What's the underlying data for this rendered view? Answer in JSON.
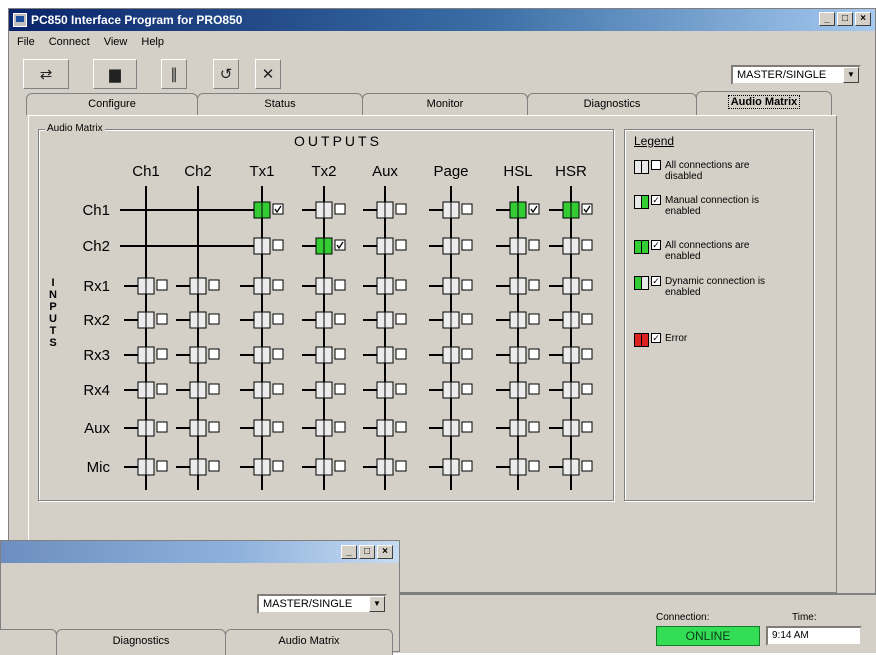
{
  "window": {
    "title": "PC850 Interface Program for PRO850"
  },
  "menu": [
    "File",
    "Connect",
    "View",
    "Help"
  ],
  "mode": {
    "selected": "MASTER/SINGLE"
  },
  "tabs": [
    {
      "label": "Configure",
      "active": false
    },
    {
      "label": "Status",
      "active": false
    },
    {
      "label": "Monitor",
      "active": false
    },
    {
      "label": "Diagnostics",
      "active": false
    },
    {
      "label": "Audio Matrix",
      "active": true
    }
  ],
  "matrix": {
    "group_label": "Audio Matrix",
    "outputs_label": "OUTPUTS",
    "inputs_label": "INPUTS",
    "outputs": [
      "Ch1",
      "Ch2",
      "Tx1",
      "Tx2",
      "Aux",
      "Page",
      "HSL",
      "HSR"
    ],
    "inputs": [
      "Ch1",
      "Ch2",
      "Rx1",
      "Rx2",
      "Rx3",
      "Rx4",
      "Aux",
      "Mic"
    ],
    "states": [
      [
        "none",
        "none",
        "manual",
        "disabled",
        "disabled",
        "disabled",
        "manual",
        "manual"
      ],
      [
        "none",
        "none",
        "disabled",
        "manual",
        "disabled",
        "disabled",
        "disabled",
        "disabled"
      ],
      [
        "disabled",
        "disabled",
        "disabled",
        "disabled",
        "disabled",
        "disabled",
        "disabled",
        "disabled"
      ],
      [
        "disabled",
        "disabled",
        "disabled",
        "disabled",
        "disabled",
        "disabled",
        "disabled",
        "disabled"
      ],
      [
        "disabled",
        "disabled",
        "disabled",
        "disabled",
        "disabled",
        "disabled",
        "disabled",
        "disabled"
      ],
      [
        "disabled",
        "disabled",
        "disabled",
        "disabled",
        "disabled",
        "disabled",
        "disabled",
        "disabled"
      ],
      [
        "disabled",
        "disabled",
        "disabled",
        "disabled",
        "disabled",
        "disabled",
        "disabled",
        "disabled"
      ],
      [
        "disabled",
        "disabled",
        "disabled",
        "disabled",
        "disabled",
        "disabled",
        "disabled",
        "disabled"
      ]
    ]
  },
  "legend": {
    "title": "Legend",
    "items": [
      {
        "text": "All connections are disabled",
        "kind": "disabled"
      },
      {
        "text": "Manual connection is enabled",
        "kind": "manual"
      },
      {
        "text": "All connections are enabled",
        "kind": "all"
      },
      {
        "text": "Dynamic connection is enabled",
        "kind": "dynamic"
      },
      {
        "text": "Error",
        "kind": "error"
      }
    ]
  },
  "status": {
    "connection_label": "Connection:",
    "connection_value": "ONLINE",
    "time_label": "Time:",
    "time_value": "9:14 AM"
  },
  "second_window": {
    "mode_selected": "MASTER/SINGLE",
    "tabs": [
      "",
      "Diagnostics",
      "Audio Matrix"
    ]
  },
  "colors": {
    "green": "#33cc33",
    "red": "#dd2222",
    "online_bg": "#33dd55"
  }
}
